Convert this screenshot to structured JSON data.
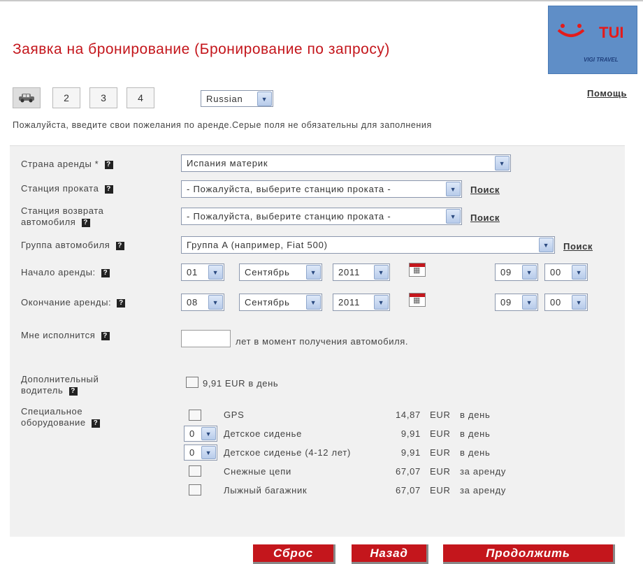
{
  "page_title_text": "Заявка на бронирование (Бронирование по запросу)",
  "logo": {
    "text": "TUI",
    "subtext": "VIGI TRAVEL"
  },
  "steps": {
    "step1_icon": "car-icon",
    "step2": "2",
    "step3": "3",
    "step4": "4"
  },
  "language_select": {
    "value": "Russian"
  },
  "help_link": "Помощь",
  "notice": "Пожалуйста, введите свои пожелания по аренде.Серые поля не обязательны для заполнения",
  "form": {
    "country": {
      "label": "Страна аренды",
      "value": "Испания материк"
    },
    "pickup_station": {
      "label": "Станция проката",
      "value": "- Пожалуйста, выберите станцию проката -",
      "search": "Поиск"
    },
    "return_station": {
      "label_line1": "Станция возврата",
      "label_line2": "автомобиля",
      "value": "- Пожалуйста, выберите станцию проката -",
      "search": "Поиск"
    },
    "car_group": {
      "label": "Группа автомобиля",
      "value": "Группа A (например, Fiat 500)",
      "search": "Поиск"
    },
    "start": {
      "label": "Начало аренды:",
      "day": "01",
      "month": "Сентябрь",
      "year": "2011",
      "hour": "09",
      "minute": "00"
    },
    "end": {
      "label": "Окончание аренды:",
      "day": "08",
      "month": "Сентябрь",
      "year": "2011",
      "hour": "09",
      "minute": "00"
    },
    "age": {
      "label": "Мне исполнится",
      "value": "",
      "suffix": "лет в момент получения автомобиля."
    },
    "extra_driver": {
      "label_line1": "Дополнительный",
      "label_line2": "водитель",
      "text": "9,91 EUR в день",
      "checked": false
    },
    "special_equipment": {
      "label_line1": "Специальное",
      "label_line2": "оборудование",
      "items": [
        {
          "control": "checkbox",
          "qty": "",
          "name": "GPS",
          "price": "14,87",
          "currency": "EUR",
          "unit": "в день"
        },
        {
          "control": "select",
          "qty": "0",
          "name": "Детское сиденье",
          "price": "9,91",
          "currency": "EUR",
          "unit": "в день"
        },
        {
          "control": "select",
          "qty": "0",
          "name": "Детское сиденье (4-12 лет)",
          "price": "9,91",
          "currency": "EUR",
          "unit": "в день"
        },
        {
          "control": "checkbox",
          "qty": "",
          "name": "Снежные цепи",
          "price": "67,07",
          "currency": "EUR",
          "unit": "за аренду"
        },
        {
          "control": "checkbox",
          "qty": "",
          "name": "Лыжный багажник",
          "price": "67,07",
          "currency": "EUR",
          "unit": "за аренду"
        }
      ]
    }
  },
  "buttons": {
    "reset": "Сброс",
    "back": "Назад",
    "continue": "Продолжить"
  },
  "colors": {
    "brand_red": "#c4161c",
    "panel_bg": "#f1f1f1",
    "logo_bg": "#5f8ec7"
  }
}
